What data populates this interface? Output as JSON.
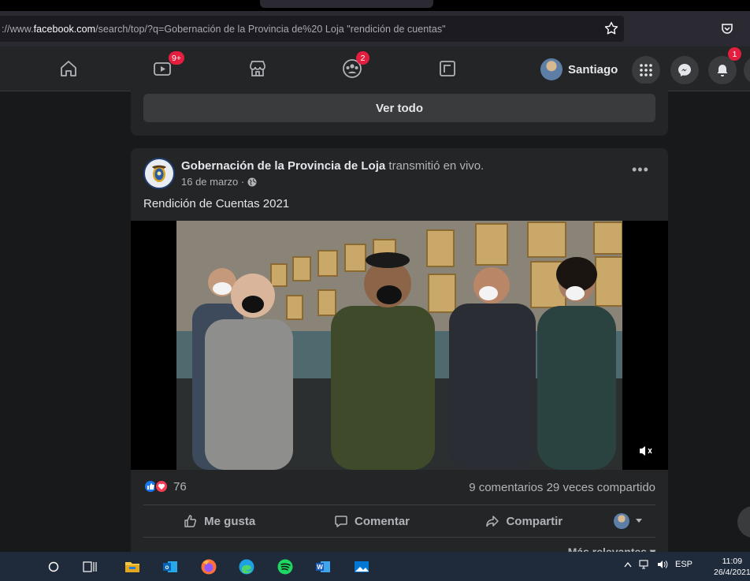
{
  "browser": {
    "url_prefix": "://www.",
    "url_domain": "facebook.com",
    "url_rest": "/search/top/?q=Gobernación de la Provincia de%20 Loja \"rendición de cuentas\""
  },
  "nav": {
    "watch_badge": "9+",
    "groups_badge": "2",
    "profile_name": "Santiago",
    "notifications_badge": "1"
  },
  "feed": {
    "see_all_label": "Ver todo"
  },
  "post": {
    "page_name": "Gobernación de la Provincia de Loja",
    "action_text": "transmitió en vivo.",
    "date": "16 de marzo ·",
    "text": "Rendición de Cuentas 2021",
    "reaction_count": "76",
    "comments": "9 comentarios",
    "shares": "29 veces compartido",
    "like_label": "Me gusta",
    "comment_label": "Comentar",
    "share_label": "Compartir",
    "sort_label": "Más relevantes ▾"
  },
  "taskbar": {
    "language": "ESP",
    "time": "11:09",
    "date": "26/4/2021"
  }
}
